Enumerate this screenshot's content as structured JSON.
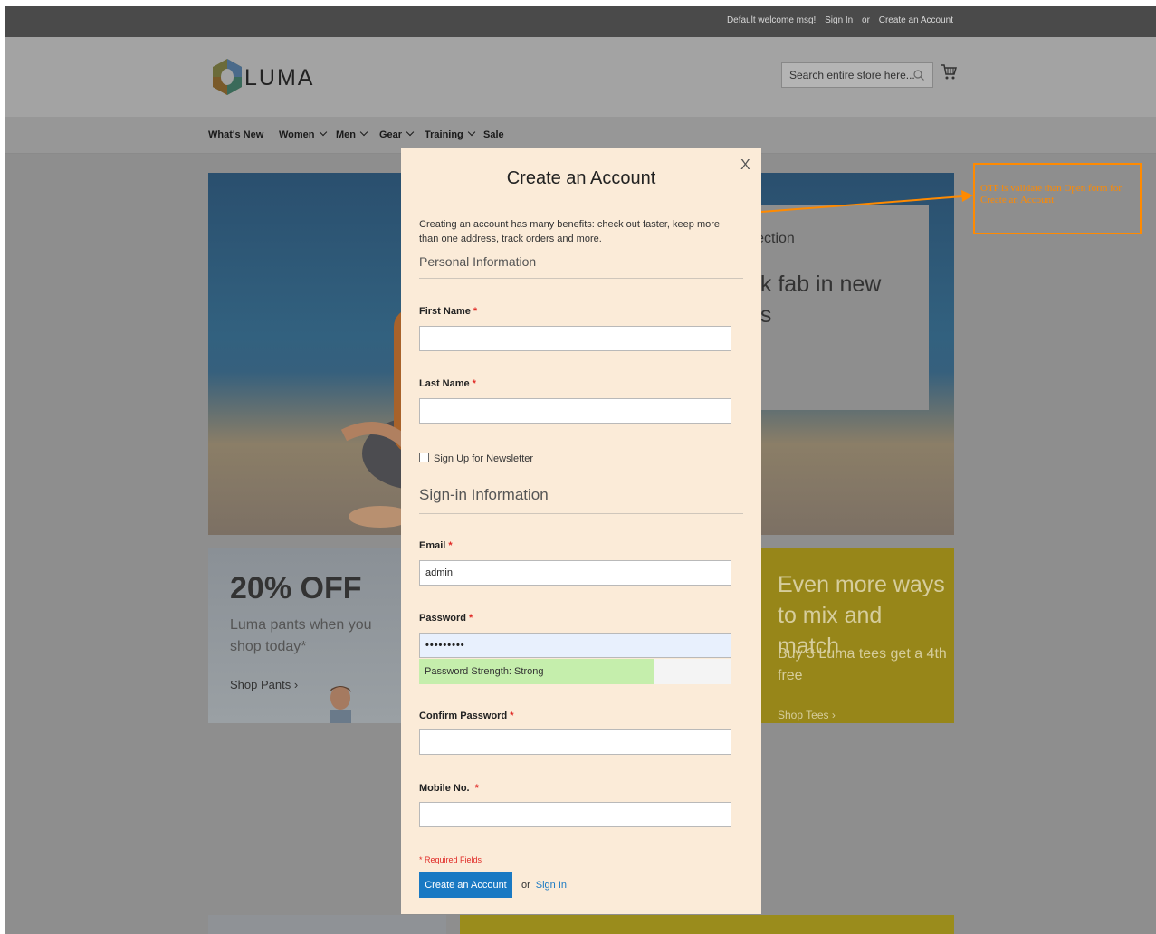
{
  "topbar": {
    "welcome": "Default welcome msg!",
    "sign_in": "Sign In",
    "or": "or",
    "create_account": "Create an Account"
  },
  "header": {
    "logo_text": "LUMA",
    "search_placeholder": "Search entire store here..."
  },
  "nav": {
    "items": [
      {
        "label": "What's New",
        "has_dropdown": false
      },
      {
        "label": "Women",
        "has_dropdown": true
      },
      {
        "label": "Men",
        "has_dropdown": true
      },
      {
        "label": "Gear",
        "has_dropdown": true
      },
      {
        "label": "Training",
        "has_dropdown": true
      },
      {
        "label": "Sale",
        "has_dropdown": false
      }
    ]
  },
  "hero": {
    "subtitle": "llection",
    "title_line1": "ok fab in new",
    "title_line2": "es"
  },
  "promo_left": {
    "headline": "20% OFF",
    "text": "Luma pants when you shop today*",
    "link": "Shop Pants ›"
  },
  "promo_right": {
    "headline": "Even more ways to mix and match",
    "text": "Buy 3 Luma tees get a 4th free",
    "link": "Shop Tees ›"
  },
  "annotation": {
    "text": "OTP is validate than Open form for Create an Account",
    "color": "#ff8a00"
  },
  "modal": {
    "title": "Create an Account",
    "close": "X",
    "intro": "Creating an account has many benefits: check out faster, keep more than one address, track orders and more.",
    "personal_legend": "Personal Information",
    "first_name_label": "First Name",
    "first_name_value": "",
    "last_name_label": "Last Name",
    "last_name_value": "",
    "newsletter_label": "Sign Up for Newsletter",
    "newsletter_checked": false,
    "signin_legend": "Sign-in Information",
    "email_label": "Email",
    "email_value": "admin",
    "password_label": "Password",
    "password_value": "•••••••••",
    "strength_text": "Password Strength: Strong",
    "strength_fraction": 0.75,
    "confirm_label": "Confirm Password",
    "confirm_value": "",
    "mobile_label": "Mobile No.",
    "mobile_value": "",
    "required_asterisk": "*",
    "required_note": "* Required Fields",
    "submit_label": "Create an Account",
    "or_text": "or",
    "signin_link": "Sign In"
  },
  "colors": {
    "accent": "#1979c3",
    "required": "#e02b27",
    "modal_bg": "#fbebd8",
    "overlay": "#8e8e8e"
  }
}
